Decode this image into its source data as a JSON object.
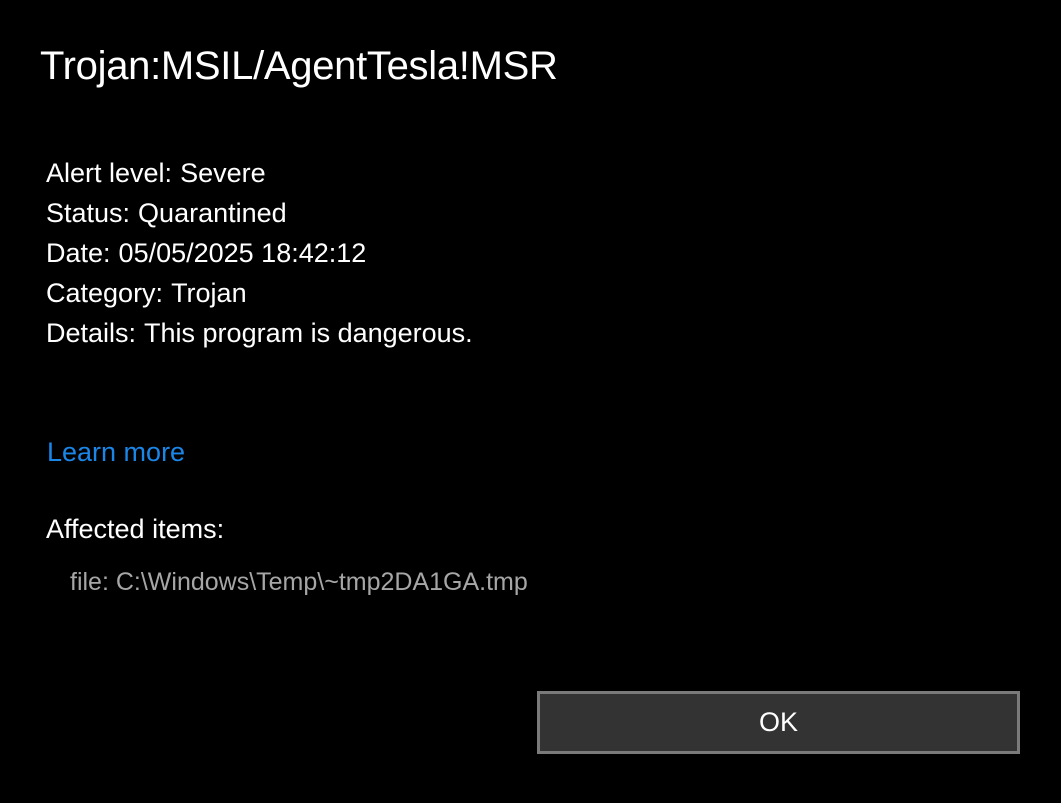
{
  "dialog": {
    "title": "Trojan:MSIL/AgentTesla!MSR",
    "details": [
      {
        "label": "Alert level:",
        "value": "Severe"
      },
      {
        "label": "Status:",
        "value": "Quarantined"
      },
      {
        "label": "Date:",
        "value": "05/05/2025 18:42:12"
      },
      {
        "label": "Category:",
        "value": "Trojan"
      },
      {
        "label": "Details:",
        "value": "This program is dangerous."
      }
    ],
    "learn_more": "Learn more",
    "affected_heading": "Affected items:",
    "affected_items": [
      "file: C:\\Windows\\Temp\\~tmp2DA1GA.tmp"
    ],
    "ok_label": "OK"
  },
  "colors": {
    "background": "#000000",
    "text": "#ffffff",
    "link": "#1a86e8",
    "muted_text": "#a6a6a6",
    "button_bg": "#333333",
    "button_border": "#7a7a7a"
  }
}
